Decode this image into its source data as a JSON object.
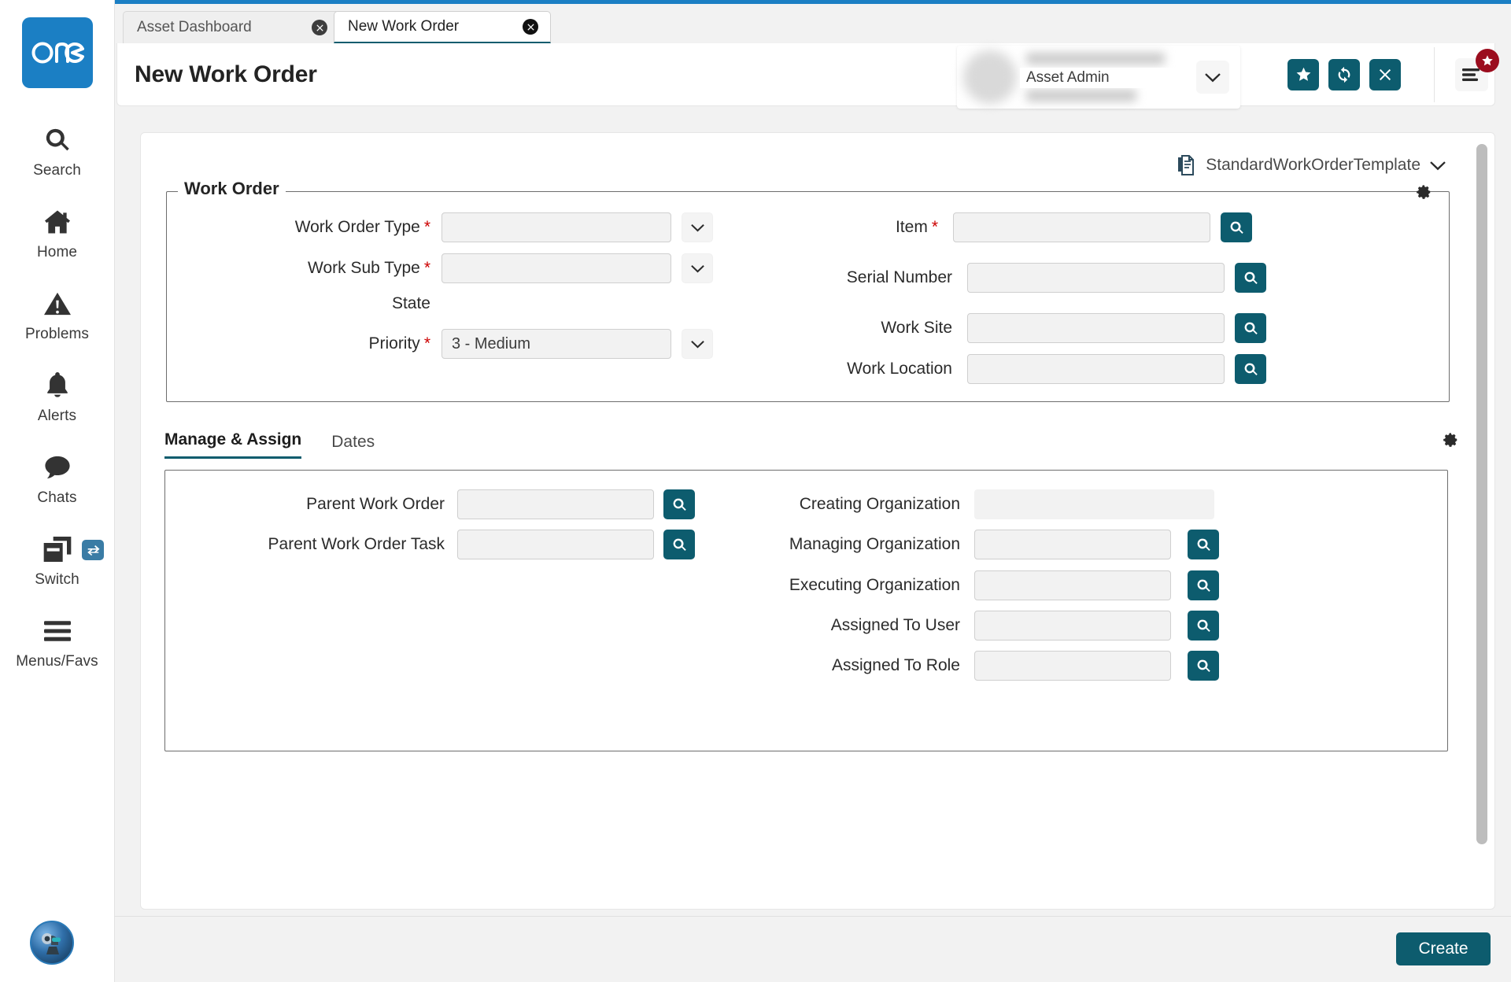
{
  "brand": {
    "logo_text": "one",
    "accent": "#0d5c6e",
    "logo_bg": "#1b7fc4"
  },
  "sidebar": {
    "items": [
      {
        "label": "Search",
        "icon": "search-icon"
      },
      {
        "label": "Home",
        "icon": "home-icon"
      },
      {
        "label": "Problems",
        "icon": "warning-triangle-icon"
      },
      {
        "label": "Alerts",
        "icon": "bell-icon"
      },
      {
        "label": "Chats",
        "icon": "chat-bubble-icon"
      },
      {
        "label": "Switch",
        "icon": "windows-stack-icon",
        "badge_icon": "swap-arrows-icon"
      },
      {
        "label": "Menus/Favs",
        "icon": "hamburger-icon"
      }
    ],
    "assistant_icon": "robot-assistant-avatar"
  },
  "tabs": [
    {
      "label": "Asset Dashboard",
      "active": false,
      "close_icon": "close-circle-icon"
    },
    {
      "label": "New Work Order",
      "active": true,
      "close_icon": "close-circle-icon"
    }
  ],
  "header": {
    "title": "New Work Order",
    "actions": [
      {
        "name": "favorite-button",
        "icon": "star-icon"
      },
      {
        "name": "refresh-button",
        "icon": "refresh-icon"
      },
      {
        "name": "close-button",
        "icon": "x-icon"
      }
    ],
    "menu_button": {
      "icon": "hamburger-icon",
      "badge_icon": "star-icon"
    },
    "user": {
      "role": "Asset Admin",
      "caret_icon": "chevron-down-icon",
      "avatar_icon": "avatar"
    }
  },
  "template_selector": {
    "icon": "copy-documents-icon",
    "name": "StandardWorkOrderTemplate",
    "caret_icon": "chevron-down-icon"
  },
  "work_order_section": {
    "legend": "Work Order",
    "gear_icon": "gear-icon",
    "left_fields": [
      {
        "label": "Work Order Type",
        "required": true,
        "value": "",
        "control": "dropdown"
      },
      {
        "label": "Work Sub Type",
        "required": true,
        "value": "",
        "control": "dropdown"
      },
      {
        "label": "State",
        "required": false,
        "value": "",
        "control": "none"
      },
      {
        "label": "Priority",
        "required": true,
        "value": "3 - Medium",
        "control": "dropdown"
      }
    ],
    "right_fields": [
      {
        "label": "Item",
        "required": true,
        "value": "",
        "control": "lookup"
      },
      {
        "label": "Serial Number",
        "required": false,
        "value": "",
        "control": "lookup"
      },
      {
        "label": "Work Site",
        "required": false,
        "value": "",
        "control": "lookup"
      },
      {
        "label": "Work Location",
        "required": false,
        "value": "",
        "control": "lookup"
      }
    ]
  },
  "section_tabs": [
    {
      "label": "Manage & Assign",
      "active": true
    },
    {
      "label": "Dates",
      "active": false
    }
  ],
  "section_gear_icon": "gear-icon",
  "manage_assign": {
    "left_fields": [
      {
        "label": "Parent Work Order",
        "required": false,
        "value": "",
        "control": "lookup"
      },
      {
        "label": "Parent Work Order Task",
        "required": false,
        "value": "",
        "control": "lookup"
      }
    ],
    "right_fields": [
      {
        "label": "Creating Organization",
        "required": false,
        "value": "",
        "control": "readonly"
      },
      {
        "label": "Managing Organization",
        "required": false,
        "value": "",
        "control": "lookup"
      },
      {
        "label": "Executing Organization",
        "required": false,
        "value": "",
        "control": "lookup"
      },
      {
        "label": "Assigned To User",
        "required": false,
        "value": "",
        "control": "lookup"
      },
      {
        "label": "Assigned To Role",
        "required": false,
        "value": "",
        "control": "lookup"
      }
    ]
  },
  "footer": {
    "create_label": "Create"
  }
}
